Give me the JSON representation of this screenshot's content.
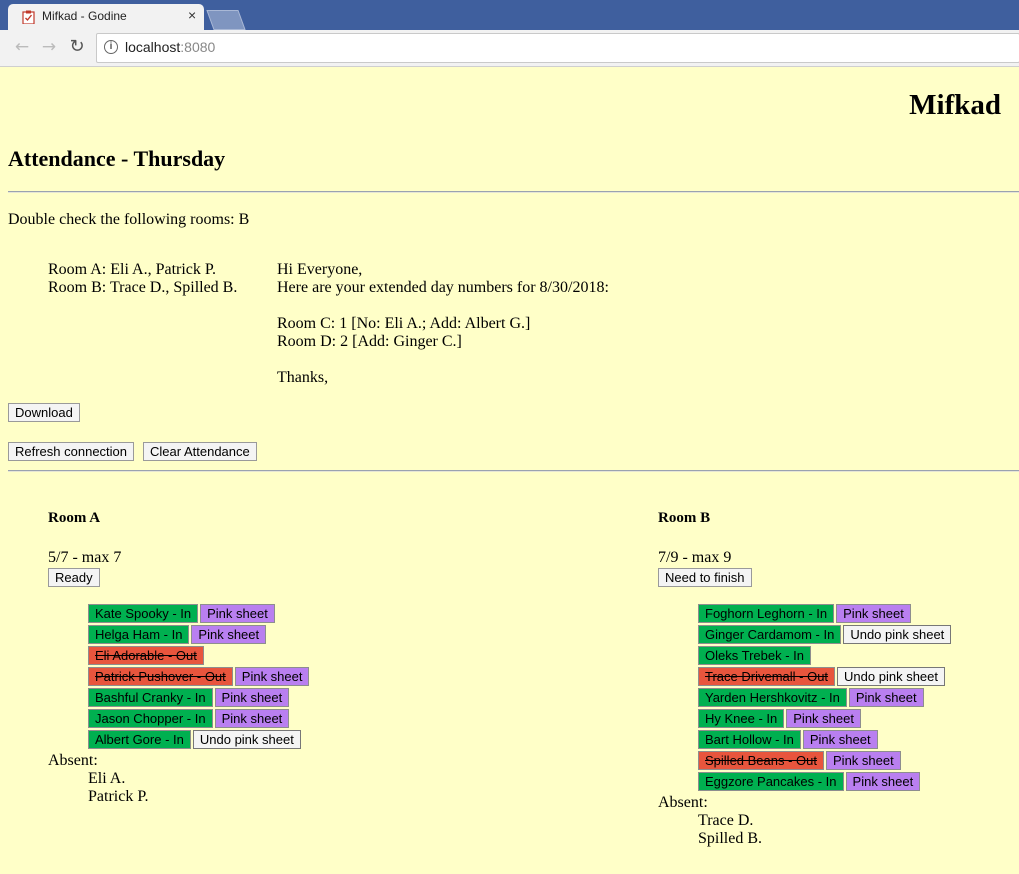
{
  "browser": {
    "tab_title": "Mifkad - Godine",
    "close_glyph": "×",
    "url_host": "localhost",
    "url_port": ":8080"
  },
  "header": {
    "app_title": "Mifkad",
    "attendance_heading": "Attendance - Thursday"
  },
  "double_check": "Double check the following rooms: B",
  "absent_summary": [
    "Room A: Eli A., Patrick P.",
    "Room B: Trace D., Spilled B."
  ],
  "message": [
    "Hi Everyone,",
    "Here are your extended day numbers for 8/30/2018:",
    "",
    "Room C: 1 [No: Eli A.; Add: Albert G.]",
    "Room D: 2 [Add: Ginger C.]",
    "",
    "Thanks,"
  ],
  "buttons": {
    "download": "Download",
    "refresh": "Refresh connection",
    "clear": "Clear Attendance"
  },
  "rooms": [
    {
      "title": "Room A",
      "count": "5/7 - max 7",
      "status_button": "Ready",
      "kids": [
        {
          "label": "Kate Spooky - In",
          "state": "in",
          "sheet": "Pink sheet"
        },
        {
          "label": "Helga Ham - In",
          "state": "in",
          "sheet": "Pink sheet"
        },
        {
          "label": "Eli Adorable - Out",
          "state": "out",
          "sheet": ""
        },
        {
          "label": "Patrick Pushover - Out",
          "state": "out",
          "sheet": "Pink sheet"
        },
        {
          "label": "Bashful Cranky - In",
          "state": "in",
          "sheet": "Pink sheet"
        },
        {
          "label": "Jason Chopper - In",
          "state": "in",
          "sheet": "Pink sheet"
        },
        {
          "label": "Albert Gore - In",
          "state": "in",
          "sheet": "Undo pink sheet"
        }
      ],
      "absent_label": "Absent:",
      "absent": [
        "Eli A.",
        "Patrick P."
      ]
    },
    {
      "title": "Room B",
      "count": "7/9 - max 9",
      "status_button": "Need to finish",
      "kids": [
        {
          "label": "Foghorn Leghorn - In",
          "state": "in",
          "sheet": "Pink sheet"
        },
        {
          "label": "Ginger Cardamom - In",
          "state": "in",
          "sheet": "Undo pink sheet"
        },
        {
          "label": "Oleks Trebek - In",
          "state": "in",
          "sheet": ""
        },
        {
          "label": "Trace Drivemall - Out",
          "state": "out",
          "sheet": "Undo pink sheet"
        },
        {
          "label": "Yarden Hershkovitz - In",
          "state": "in",
          "sheet": "Pink sheet"
        },
        {
          "label": "Hy Knee - In",
          "state": "in",
          "sheet": "Pink sheet"
        },
        {
          "label": "Bart Hollow - In",
          "state": "in",
          "sheet": "Pink sheet"
        },
        {
          "label": "Spilled Beans - Out",
          "state": "out",
          "sheet": "Pink sheet"
        },
        {
          "label": "Eggzore Pancakes - In",
          "state": "in",
          "sheet": "Pink sheet"
        }
      ],
      "absent_label": "Absent:",
      "absent": [
        "Trace D.",
        "Spilled B."
      ]
    }
  ],
  "colors": {
    "page_bg": "#ffffc8",
    "in": "#00b050",
    "out": "#e8553d",
    "pink_sheet": "#b97ff0"
  }
}
